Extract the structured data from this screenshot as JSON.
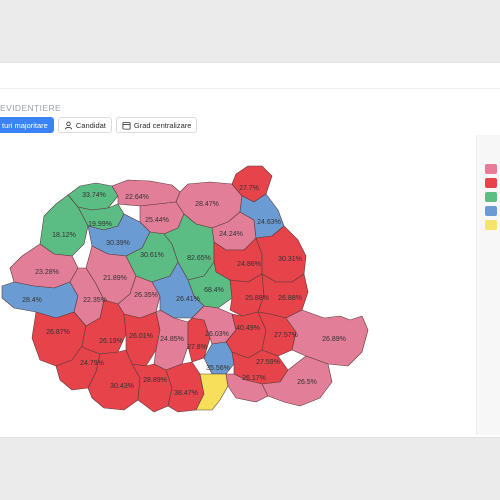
{
  "header": {
    "section_title": "EVIDENȚIERE",
    "buttons": [
      {
        "label": "turi majoritare",
        "active": true
      },
      {
        "label": "Candidat",
        "active": false,
        "icon": "user-icon"
      },
      {
        "label": "Grad centralizare",
        "active": false,
        "icon": "calendar-icon"
      }
    ]
  },
  "legend": {
    "colors": [
      "#e87c98",
      "#e8434a",
      "#5bbf82",
      "#6b9bd1",
      "#f5e36b"
    ]
  },
  "palette": {
    "pink": "#e37e98",
    "red": "#e6434b",
    "green": "#5bbd83",
    "blue": "#6a9bd2",
    "yellow": "#f5df5b"
  },
  "map": {
    "labels": [
      {
        "id": "satu-mare",
        "text": "33.74%"
      },
      {
        "id": "maramures",
        "text": "22.64%"
      },
      {
        "id": "suceava",
        "text": "28.47%"
      },
      {
        "id": "botosani",
        "text": "27.7%"
      },
      {
        "id": "salaj",
        "text": "19.99%"
      },
      {
        "id": "bistrita",
        "text": "25.44%"
      },
      {
        "id": "bihor",
        "text": "18.12%"
      },
      {
        "id": "cluj",
        "text": "30.39%"
      },
      {
        "id": "neamt",
        "text": "24.24%"
      },
      {
        "id": "iasi",
        "text": "24.63%"
      },
      {
        "id": "mures",
        "text": "30.61%"
      },
      {
        "id": "harghita",
        "text": "82.65%"
      },
      {
        "id": "bacau",
        "text": "24.86%"
      },
      {
        "id": "vaslui",
        "text": "30.31%"
      },
      {
        "id": "arad",
        "text": "23.28%"
      },
      {
        "id": "alba",
        "text": "21.89%"
      },
      {
        "id": "covasna",
        "text": "68.4%"
      },
      {
        "id": "timis",
        "text": "28.4%"
      },
      {
        "id": "hunedoara",
        "text": "22.35%"
      },
      {
        "id": "sibiu",
        "text": "26.35%"
      },
      {
        "id": "brasov",
        "text": "26.41%"
      },
      {
        "id": "vrancea",
        "text": "25.88%"
      },
      {
        "id": "galati",
        "text": "26.88%"
      },
      {
        "id": "caras",
        "text": "26.87%"
      },
      {
        "id": "gorj",
        "text": "26.19%"
      },
      {
        "id": "valcea",
        "text": "26.01%"
      },
      {
        "id": "arges",
        "text": "24.85%"
      },
      {
        "id": "dambovita",
        "text": "27.8%"
      },
      {
        "id": "prahova",
        "text": "26.03%"
      },
      {
        "id": "buzau",
        "text": "40.49%"
      },
      {
        "id": "braila",
        "text": "27.57%"
      },
      {
        "id": "tulcea",
        "text": "26.89%"
      },
      {
        "id": "mehedinti",
        "text": "24.79%"
      },
      {
        "id": "dolj",
        "text": "30.43%"
      },
      {
        "id": "olt",
        "text": "28.89%"
      },
      {
        "id": "teleorman",
        "text": "38.47%"
      },
      {
        "id": "ilfov",
        "text": "35.56%"
      },
      {
        "id": "ialomita",
        "text": "27.59%"
      },
      {
        "id": "calarasi",
        "text": "26.17%"
      },
      {
        "id": "constanta",
        "text": "26.5%"
      }
    ]
  }
}
